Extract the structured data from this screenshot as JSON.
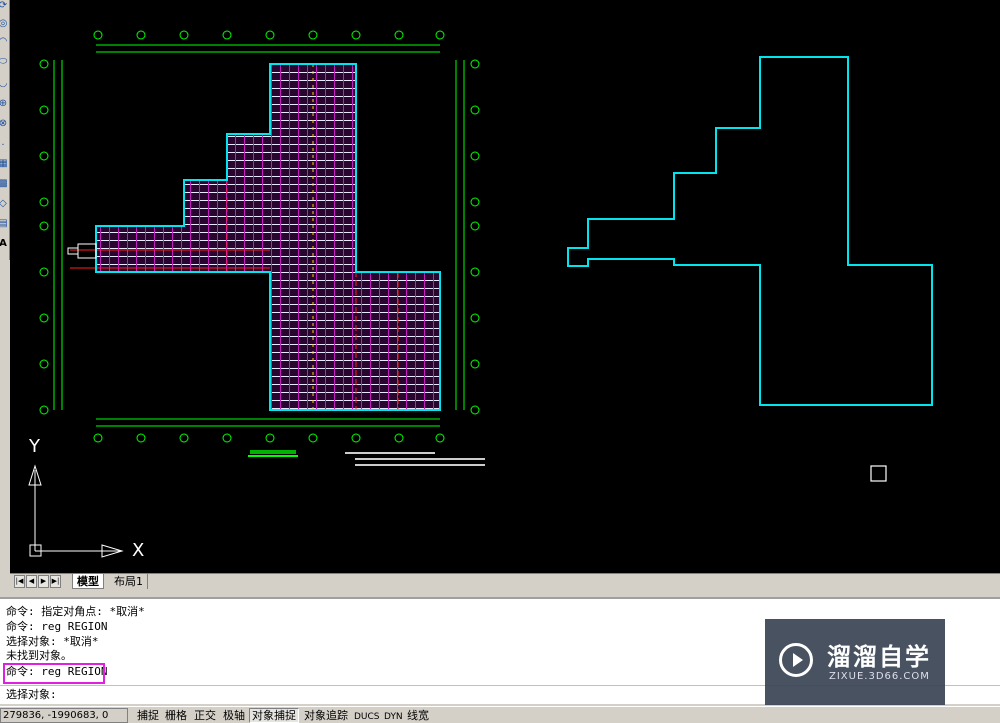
{
  "left_toolbar": {
    "icons": [
      "pen-icon",
      "region-icon",
      "revcloud-icon",
      "ellipse-icon",
      "ellipse-arc-icon",
      "insert-block-icon",
      "make-block-icon",
      "point-icon",
      "hatch-icon",
      "gradient-icon",
      "boundary-icon",
      "table-icon",
      "mtext-icon"
    ],
    "text_tool_glyph": "A"
  },
  "canvas": {
    "ucs_x_label": "X",
    "ucs_y_label": "Y",
    "colors": {
      "background": "#000000",
      "outline": "#00e5ee",
      "grid_magenta": "#c020c0",
      "grid_white": "#ffffff",
      "axis_green": "#00ff00",
      "accent_red": "#ff2020",
      "accent_yellow": "#ffd000"
    }
  },
  "tabs": {
    "nav_glyphs": [
      "|◀",
      "◀",
      "▶",
      "▶|"
    ],
    "model": "模型",
    "layout1": "布局1"
  },
  "command": {
    "lines": [
      "命令: 指定对角点: *取消*",
      "命令: reg REGION",
      "选择对象: *取消*",
      "未找到对象。",
      "命令: reg REGION"
    ],
    "prompt": "选择对象:"
  },
  "watermark": {
    "title": "溜溜自学",
    "url": "ZIXUE.3D66.COM"
  },
  "status_bar": {
    "coordinates": "279836, -1990683, 0",
    "toggles": [
      {
        "label": "捕捉",
        "on": false
      },
      {
        "label": "栅格",
        "on": false
      },
      {
        "label": "正交",
        "on": false
      },
      {
        "label": "极轴",
        "on": false
      },
      {
        "label": "对象捕捉",
        "on": true
      },
      {
        "label": "对象追踪",
        "on": false
      },
      {
        "label": "DUCS",
        "on": false
      },
      {
        "label": "DYN",
        "on": false
      },
      {
        "label": "线宽",
        "on": false
      }
    ]
  }
}
